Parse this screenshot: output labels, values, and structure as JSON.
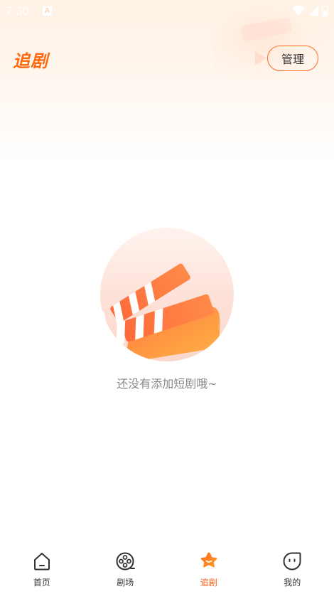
{
  "status_bar": {
    "time": "7:30",
    "notification_letter": "A"
  },
  "header": {
    "title": "追剧",
    "manage_label": "管理"
  },
  "empty_state": {
    "message": "还没有添加短剧哦~"
  },
  "bottom_nav": {
    "items": [
      {
        "label": "首页",
        "icon": "home-icon"
      },
      {
        "label": "剧场",
        "icon": "film-reel-icon"
      },
      {
        "label": "追剧",
        "icon": "star-icon"
      },
      {
        "label": "我的",
        "icon": "smiley-face-icon"
      }
    ],
    "active_index": 2
  },
  "colors": {
    "accent": "#ff6a10",
    "active_nav": "#ff5a14",
    "text_primary": "#333333",
    "text_secondary": "#8a8a8a"
  }
}
